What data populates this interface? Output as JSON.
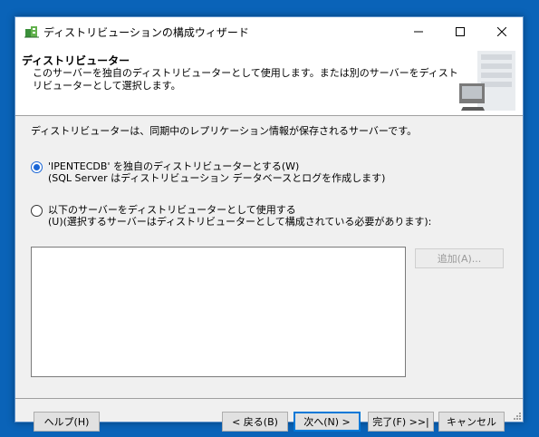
{
  "window": {
    "title": "ディストリビューションの構成ウィザード"
  },
  "header": {
    "title": "ディストリビューター",
    "description": "このサーバーを独自のディストリビューターとして使用します。または別のサーバーをディストリビューターとして選択します。"
  },
  "body": {
    "intro": "ディストリビューターは、同期中のレプリケーション情報が保存されるサーバーです。",
    "options": [
      {
        "line1": "'IPENTECDB' を独自のディストリビューターとする(W)",
        "line2": "(SQL Server はディストリビューション データベースとログを作成します)",
        "checked": true
      },
      {
        "line1": "以下のサーバーをディストリビューターとして使用する",
        "line2": "(U)(選択するサーバーはディストリビューターとして構成されている必要があります):",
        "checked": false
      }
    ],
    "add_button": "追加(A)..."
  },
  "footer": {
    "help": "ヘルプ(H)",
    "back": "< 戻る(B)",
    "next": "次へ(N) >",
    "finish": "完了(F) >>|",
    "cancel": "キャンセル"
  },
  "icons": {
    "app": "wizard-app-icon",
    "minimize": "minimize-icon",
    "maximize": "maximize-icon",
    "close": "close-icon",
    "header_graphic": "server-computer-icon"
  },
  "colors": {
    "desktop": "#0a63b8",
    "radio_accent": "#1a66d6",
    "default_button_border": "#0078d7"
  }
}
